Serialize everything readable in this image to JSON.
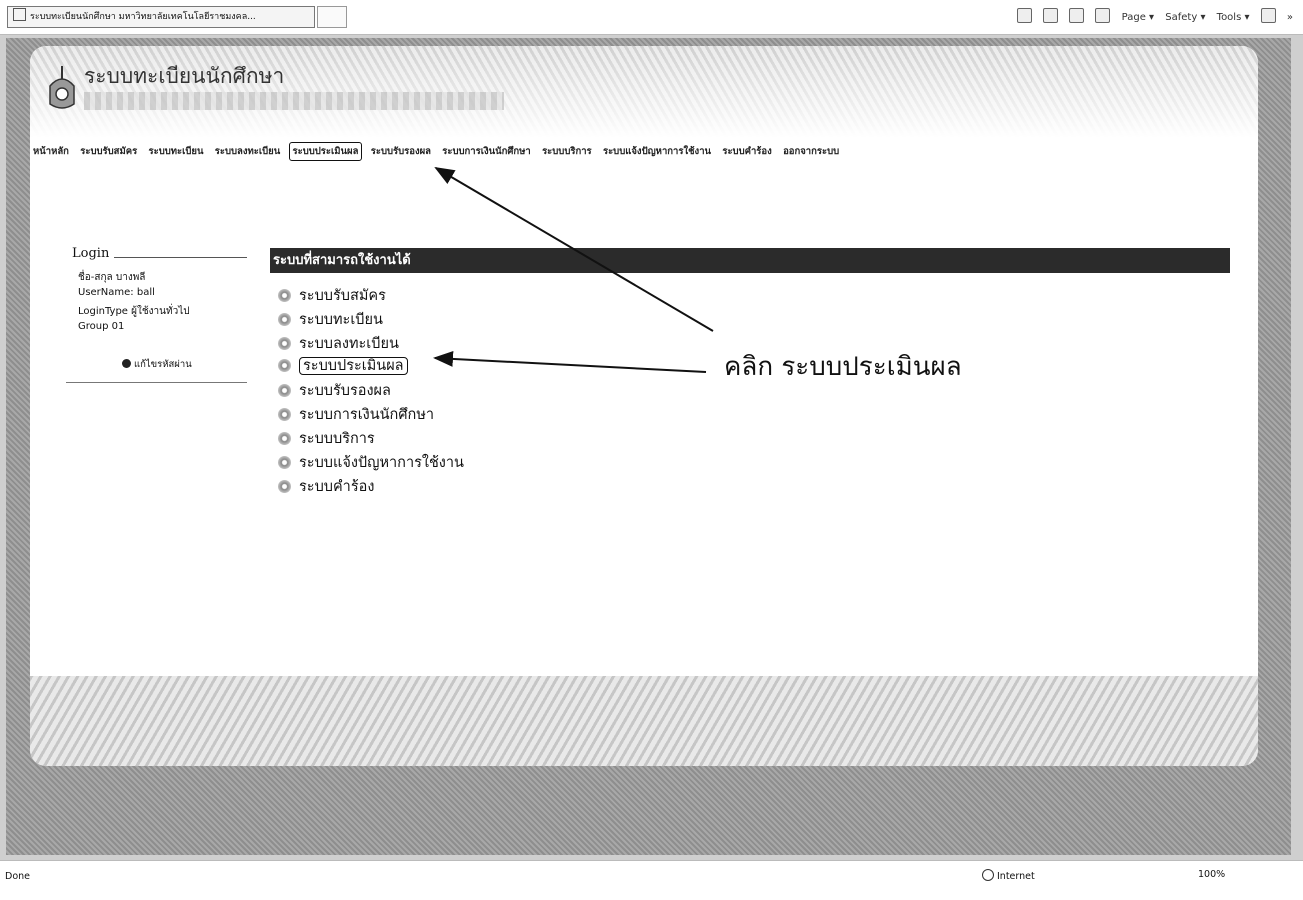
{
  "browser": {
    "tab_title": "ระบบทะเบียนนักศึกษา มหาวิทยาลัยเทคโนโลยีราชมงคล...",
    "commands": [
      "Page ▾",
      "Safety ▾",
      "Tools ▾"
    ],
    "overflow": "»"
  },
  "site": {
    "title": "ระบบทะเบียนนักศึกษา"
  },
  "topnav": [
    "หน้าหลัก",
    "ระบบรับสมัคร",
    "ระบบทะเบียน",
    "ระบบลงทะเบียน",
    "ระบบประเมินผล",
    "ระบบรับรองผล",
    "ระบบการเงินนักศึกษา",
    "ระบบบริการ",
    "ระบบแจ้งปัญหาการใช้งาน",
    "ระบบคำร้อง",
    "ออกจากระบบ"
  ],
  "login": {
    "legend": "Login",
    "fields": [
      "ชื่อ-สกุล บางพลี",
      "UserName: ball",
      "LoginType ผู้ใช้งานทั่วไป",
      "Group    01"
    ],
    "edit_password": "แก้ไขรหัสผ่าน"
  },
  "systems": {
    "header": "ระบบที่สามารถใช้งานได้",
    "items": [
      "ระบบรับสมัคร",
      "ระบบทะเบียน",
      "ระบบลงทะเบียน",
      "ระบบประเมินผล",
      "ระบบรับรองผล",
      "ระบบการเงินนักศึกษา",
      "ระบบบริการ",
      "ระบบแจ้งปัญหาการใช้งาน",
      "ระบบคำร้อง"
    ]
  },
  "annotation": {
    "callout": "คลิก ระบบประเมินผล"
  },
  "status": {
    "left": "Done",
    "zone": "Internet",
    "zoom": "100%"
  }
}
